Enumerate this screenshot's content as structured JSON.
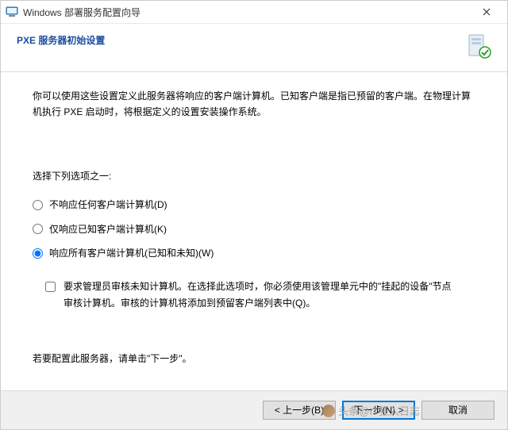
{
  "titlebar": {
    "title": "Windows 部署服务配置向导"
  },
  "header": {
    "heading": "PXE 服务器初始设置"
  },
  "body": {
    "intro": "你可以使用这些设置定义此服务器将响应的客户端计算机。已知客户端是指已预留的客户端。在物理计算机执行 PXE 启动时，将根据定义的设置安装操作系统。",
    "prompt": "选择下列选项之一:",
    "options": [
      {
        "label": "不响应任何客户端计算机(D)"
      },
      {
        "label": "仅响应已知客户端计算机(K)"
      },
      {
        "label": "响应所有客户端计算机(已知和未知)(W)"
      }
    ],
    "checkbox": {
      "label": "要求管理员审核未知计算机。在选择此选项时，你必须使用该管理单元中的\"挂起的设备\"节点审核计算机。审核的计算机将添加到预留客户端列表中(Q)。"
    },
    "instruction": "若要配置此服务器，请单击\"下一步\"。"
  },
  "footer": {
    "back": "< 上一步(B)",
    "next": "下一步(N) >",
    "cancel": "取消"
  },
  "watermark": "头条@IT狂人日志"
}
